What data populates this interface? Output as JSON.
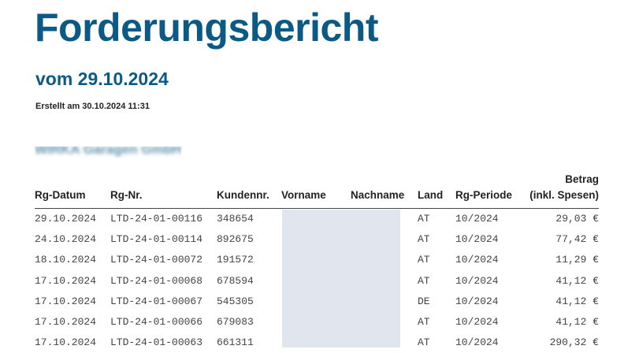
{
  "report": {
    "title": "Forderungsbericht",
    "subtitle": "vom 29.10.2024",
    "created": "Erstellt am 30.10.2024 11:31",
    "company": "WIRKA Garagen GmbH"
  },
  "table": {
    "headers": {
      "date": "Rg-Datum",
      "number": "Rg-Nr.",
      "customer": "Kundennr.",
      "firstname": "Vorname",
      "lastname": "Nachname",
      "country": "Land",
      "period": "Rg-Periode",
      "amount_line1": "Betrag",
      "amount_line2": "(inkl. Spesen)"
    },
    "rows": [
      {
        "date": "29.10.2024",
        "number": "LTD-24-01-00116",
        "customer": "348654",
        "firstname": "",
        "lastname": "",
        "country": "AT",
        "period": "10/2024",
        "amount": "29,03 €"
      },
      {
        "date": "24.10.2024",
        "number": "LTD-24-01-00114",
        "customer": "892675",
        "firstname": "",
        "lastname": "",
        "country": "AT",
        "period": "10/2024",
        "amount": "77,42 €"
      },
      {
        "date": "18.10.2024",
        "number": "LTD-24-01-00072",
        "customer": "191572",
        "firstname": "",
        "lastname": "",
        "country": "AT",
        "period": "10/2024",
        "amount": "11,29 €"
      },
      {
        "date": "17.10.2024",
        "number": "LTD-24-01-00068",
        "customer": "678594",
        "firstname": "",
        "lastname": "",
        "country": "AT",
        "period": "10/2024",
        "amount": "41,12 €"
      },
      {
        "date": "17.10.2024",
        "number": "LTD-24-01-00067",
        "customer": "545305",
        "firstname": "",
        "lastname": "",
        "country": "DE",
        "period": "10/2024",
        "amount": "41,12 €"
      },
      {
        "date": "17.10.2024",
        "number": "LTD-24-01-00066",
        "customer": "679083",
        "firstname": "",
        "lastname": "",
        "country": "AT",
        "period": "10/2024",
        "amount": "41,12 €"
      },
      {
        "date": "17.10.2024",
        "number": "LTD-24-01-00063",
        "customer": "661311",
        "firstname": "",
        "lastname": "",
        "country": "AT",
        "period": "10/2024",
        "amount": "290,32 €"
      }
    ]
  },
  "colors": {
    "heading": "#0b5a86",
    "redaction": "#e1e6ee"
  }
}
